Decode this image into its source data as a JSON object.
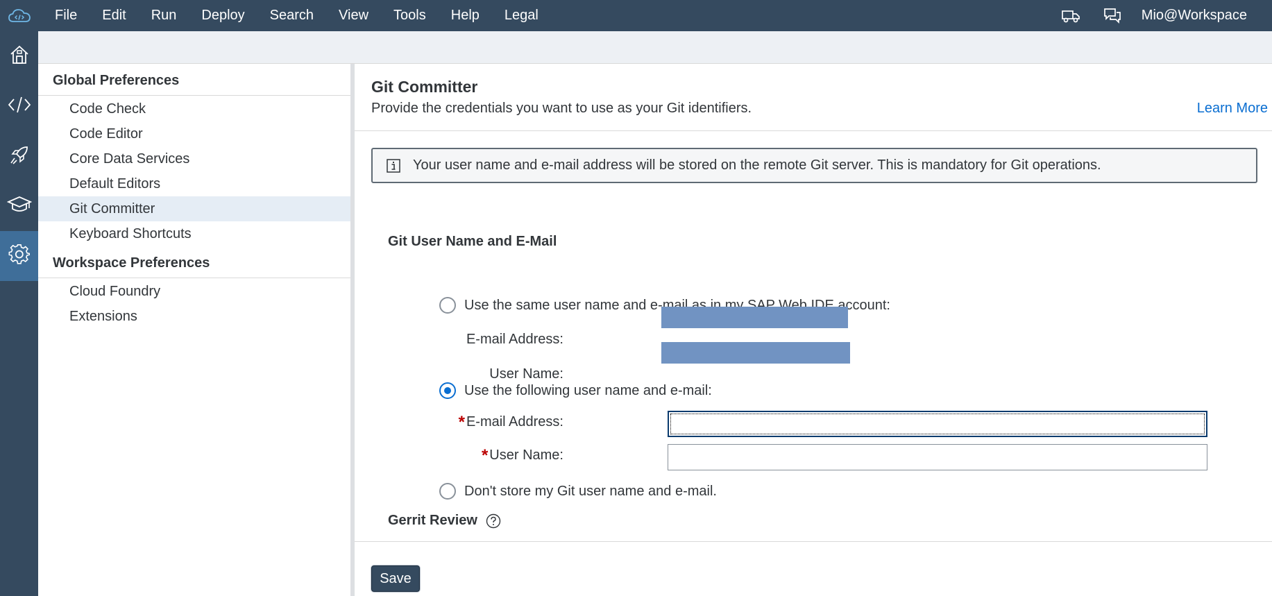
{
  "menubar": {
    "logo_icon": "cloud-code-icon",
    "items": [
      "File",
      "Edit",
      "Run",
      "Deploy",
      "Search",
      "View",
      "Tools",
      "Help",
      "Legal"
    ],
    "right_icons": [
      "delivery-truck-icon",
      "chat-icon"
    ],
    "user": "Mio@Workspace"
  },
  "rail": {
    "buttons": [
      {
        "icon": "home-icon",
        "active": false
      },
      {
        "icon": "code-icon",
        "active": false
      },
      {
        "icon": "rocket-icon",
        "active": false
      },
      {
        "icon": "learning-hat-icon",
        "active": false
      },
      {
        "icon": "settings-gear-icon",
        "active": true
      }
    ]
  },
  "tree": {
    "global_title": "Global Preferences",
    "global_items": [
      "Code Check",
      "Code Editor",
      "Core Data Services",
      "Default Editors",
      "Git Committer",
      "Keyboard Shortcuts"
    ],
    "selected": "Git Committer",
    "workspace_title": "Workspace Preferences",
    "workspace_items": [
      "Cloud Foundry",
      "Extensions"
    ]
  },
  "content": {
    "title": "Git Committer",
    "subtitle": "Provide the credentials you want to use as your Git identifiers.",
    "learn_more": "Learn More",
    "info_icon": "information-icon",
    "info_message": "Your user name and e-mail address will be stored on the remote Git server. This is mandatory for Git operations.",
    "section_title": "Git User Name and E-Mail",
    "option_same": "Use the same user name and e-mail as in my SAP Web IDE account:",
    "option_following": "Use the following user name and e-mail:",
    "option_none": "Don't store my Git user name and e-mail.",
    "selected_option": "option_following",
    "email_label": "E-mail Address:",
    "username_label": "User Name:",
    "required_marker": "*",
    "email_value": "",
    "username_value": "",
    "gerrit_label": "Gerrit Review",
    "gerrit_icon": "help-circle-icon",
    "save_label": "Save"
  },
  "colors": {
    "shell": "#354a5f",
    "accent": "#0a6ed1",
    "selected_row": "#e5edf5",
    "masked_value": "#7193c2",
    "required": "#bb0000"
  }
}
